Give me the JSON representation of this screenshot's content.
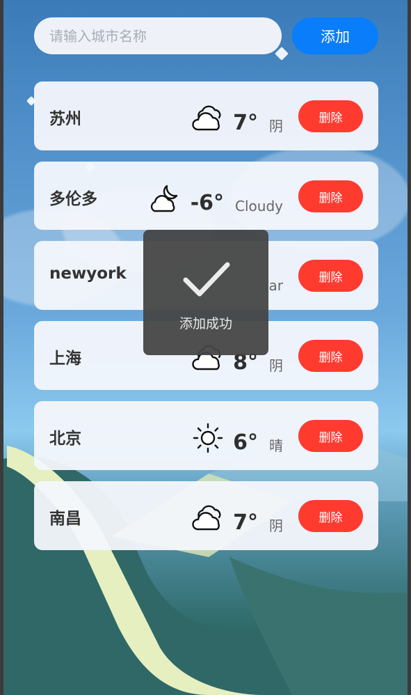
{
  "search": {
    "placeholder": "请输入城市名称",
    "value": ""
  },
  "add_button_label": "添加",
  "cities": [
    {
      "name": "苏州",
      "temp": "7°",
      "condition": "阴",
      "icon": "cloudy-icon",
      "delete_label": "删除"
    },
    {
      "name": "多伦多",
      "temp": "-6°",
      "condition": "Cloudy",
      "icon": "cloud-moon-icon",
      "delete_label": "删除"
    },
    {
      "name": "newyork",
      "temp": "",
      "condition": "ar",
      "icon": "",
      "delete_label": "删除"
    },
    {
      "name": "上海",
      "temp": "8°",
      "condition": "阴",
      "icon": "cloudy-icon",
      "delete_label": "删除"
    },
    {
      "name": "北京",
      "temp": "6°",
      "condition": "晴",
      "icon": "sun-icon",
      "delete_label": "删除"
    },
    {
      "name": "南昌",
      "temp": "7°",
      "condition": "阴",
      "icon": "cloudy-icon",
      "delete_label": "删除"
    }
  ],
  "toast": {
    "icon": "checkmark-icon",
    "text": "添加成功"
  },
  "colors": {
    "accent": "#0a7dfa",
    "danger": "#ff3b30",
    "card": "#f4f7fc"
  }
}
